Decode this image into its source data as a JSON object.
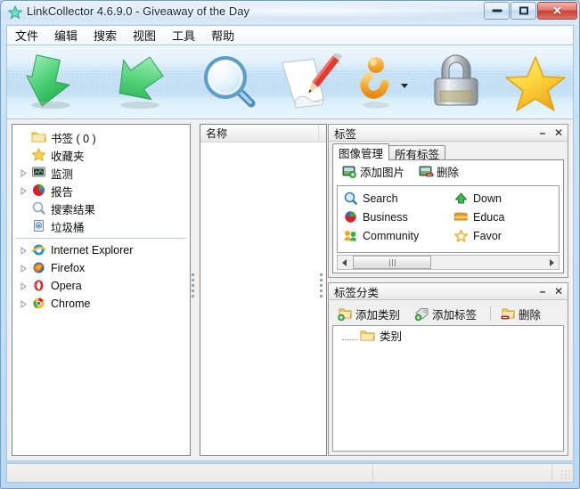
{
  "window": {
    "title": "LinkCollector 4.6.9.0 - Giveaway of the Day",
    "app_icon": "star-icon",
    "controls": {
      "minimize": "minimize-button",
      "maximize": "maximize-button",
      "close_label": "✕"
    }
  },
  "menubar": {
    "items": [
      {
        "label": "文件",
        "name": "menu-file"
      },
      {
        "label": "编辑",
        "name": "menu-edit"
      },
      {
        "label": "搜索",
        "name": "menu-search"
      },
      {
        "label": "视图",
        "name": "menu-view"
      },
      {
        "label": "工具",
        "name": "menu-tools"
      },
      {
        "label": "帮助",
        "name": "menu-help"
      }
    ]
  },
  "toolbar": {
    "buttons": [
      {
        "icon": "import-arrow-down-icon",
        "name": "toolbar-import"
      },
      {
        "icon": "export-arrow-up-icon",
        "name": "toolbar-export"
      },
      {
        "icon": "magnifier-search-icon",
        "name": "toolbar-search"
      },
      {
        "icon": "edit-pencil-paper-icon",
        "name": "toolbar-edit"
      },
      {
        "icon": "info-person-icon",
        "name": "toolbar-info",
        "has_dropdown": true
      },
      {
        "icon": "padlock-icon",
        "name": "toolbar-lock"
      },
      {
        "icon": "star-icon",
        "name": "toolbar-favorites"
      }
    ]
  },
  "tree": {
    "items": [
      {
        "label": "书签 ( 0 )",
        "icon": "folder-icon",
        "expandable": false,
        "name": "tree-item-bookmarks"
      },
      {
        "label": "收藏夹",
        "icon": "star-icon",
        "expandable": false,
        "name": "tree-item-favorites"
      },
      {
        "label": "监测",
        "icon": "monitor-icon",
        "expandable": true,
        "name": "tree-item-monitor"
      },
      {
        "label": "报告",
        "icon": "pie-chart-icon",
        "expandable": true,
        "name": "tree-item-report"
      },
      {
        "label": "搜索结果",
        "icon": "magnifier-icon",
        "expandable": false,
        "name": "tree-item-search-results"
      },
      {
        "label": "垃圾桶",
        "icon": "trash-icon",
        "expandable": false,
        "name": "tree-item-trash"
      },
      {
        "label": "Internet Explorer",
        "icon": "ie-icon",
        "expandable": true,
        "name": "tree-item-internet-explorer"
      },
      {
        "label": "Firefox",
        "icon": "firefox-icon",
        "expandable": true,
        "name": "tree-item-firefox"
      },
      {
        "label": "Opera",
        "icon": "opera-icon",
        "expandable": true,
        "name": "tree-item-opera"
      },
      {
        "label": "Chrome",
        "icon": "chrome-icon",
        "expandable": true,
        "name": "tree-item-chrome"
      }
    ],
    "separator_after_index": 5
  },
  "list_panel": {
    "columns": [
      "名称"
    ],
    "rows": []
  },
  "tags_panel": {
    "title": "标签",
    "minimize_glyph": "–",
    "close_glyph": "✕",
    "tabs": [
      {
        "label": "图像管理",
        "active": true,
        "name": "tab-image-management"
      },
      {
        "label": "所有标签",
        "active": false,
        "name": "tab-all-tags"
      }
    ],
    "commands": [
      {
        "label": "添加图片",
        "icon": "image-add-icon",
        "name": "add-image-button"
      },
      {
        "label": "删除",
        "icon": "image-remove-icon",
        "name": "delete-image-button"
      }
    ],
    "tags_left": [
      {
        "label": "Search",
        "icon": "magnifier-icon"
      },
      {
        "label": "Business",
        "icon": "pie-chart-icon"
      },
      {
        "label": "Community",
        "icon": "people-icon"
      }
    ],
    "tags_right": [
      {
        "label": "Down",
        "icon": "download-arrow-icon"
      },
      {
        "label": "Educa",
        "icon": "book-icon"
      },
      {
        "label": "Favor",
        "icon": "star-outline-icon"
      }
    ],
    "scrollbar": {
      "left_arrow": "◄",
      "right_arrow": "►",
      "thumb_grip": "|||"
    }
  },
  "tag_category_panel": {
    "title": "标签分类",
    "minimize_glyph": "–",
    "close_glyph": "✕",
    "commands": [
      {
        "label": "添加类别",
        "icon": "folder-add-icon",
        "name": "add-category-button"
      },
      {
        "label": "添加标签",
        "icon": "tag-add-icon",
        "name": "add-tag-button"
      },
      {
        "label": "删除",
        "icon": "folder-remove-icon",
        "name": "delete-category-button"
      }
    ],
    "tree": [
      {
        "label": "类别",
        "icon": "folder-icon",
        "name": "category-root-node"
      }
    ]
  },
  "statusbar": {
    "cells": [
      "",
      "",
      ""
    ],
    "grip": "resize-grip"
  },
  "colors": {
    "aero_frame": "#b7d3ec",
    "titlebar": "#dceaf7",
    "close_red": "#c8403a",
    "panel_bg": "#f0f0f0",
    "accent_green": "#3fbb4b",
    "accent_orange": "#f5a623"
  }
}
